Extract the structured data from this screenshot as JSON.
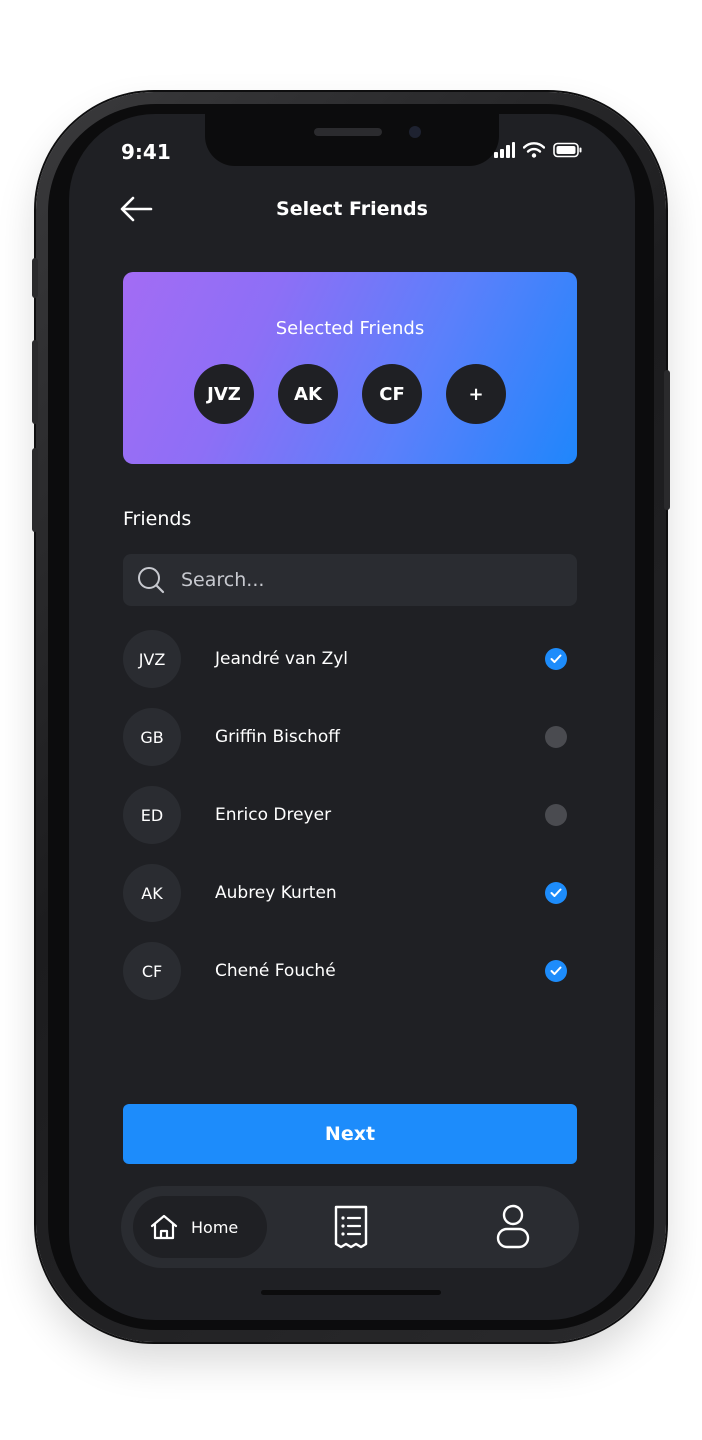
{
  "status_bar": {
    "time": "9:41"
  },
  "header": {
    "title": "Select Friends"
  },
  "selected": {
    "title": "Selected Friends",
    "chips": [
      "JVZ",
      "AK",
      "CF"
    ],
    "add_label": "+"
  },
  "friends": {
    "label": "Friends",
    "search_placeholder": "Search...",
    "items": [
      {
        "initials": "JVZ",
        "name": "Jeandré van Zyl",
        "selected": true
      },
      {
        "initials": "GB",
        "name": "Griffin Bischoff",
        "selected": false
      },
      {
        "initials": "ED",
        "name": "Enrico Dreyer",
        "selected": false
      },
      {
        "initials": "AK",
        "name": "Aubrey Kurten",
        "selected": true
      },
      {
        "initials": "CF",
        "name": "Chené Fouché",
        "selected": true
      }
    ]
  },
  "actions": {
    "next_label": "Next"
  },
  "nav": {
    "home_label": "Home"
  },
  "colors": {
    "background": "#1f2024",
    "surface": "#2a2c31",
    "accent": "#1d8cfb",
    "gradient_start": "#a36cf4",
    "gradient_end": "#1f86fb"
  }
}
